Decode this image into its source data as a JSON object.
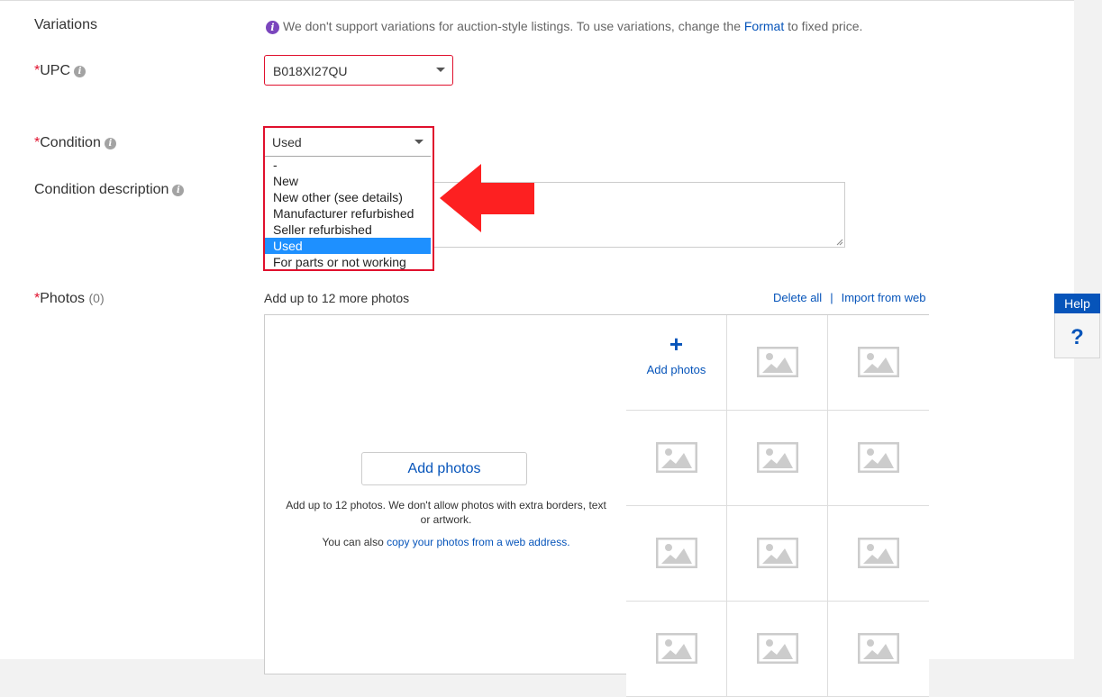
{
  "variations": {
    "label": "Variations",
    "note_before": "We don't support variations for auction-style listings. To use variations, change the ",
    "note_link": "Format",
    "note_after": " to fixed price."
  },
  "upc": {
    "label": "UPC",
    "value": "B018XI27QU"
  },
  "condition": {
    "label": "Condition",
    "value": "Used",
    "options": [
      "-",
      "New",
      "New other (see details)",
      "Manufacturer refurbished",
      "Seller refurbished",
      "Used",
      "For parts or not working"
    ],
    "selected_option": "Used"
  },
  "condition_description": {
    "label": "Condition description",
    "value": ""
  },
  "photos": {
    "label": "Photos",
    "count": "(0)",
    "hint": "Add up to 12 more photos",
    "delete_all": "Delete all",
    "separator": "|",
    "import_from_web": "Import from web",
    "add_photos_button": "Add photos",
    "add_tile_label": "Add photos",
    "add_tile_symbol": "+",
    "note": "Add up to 12 photos. We don't allow photos with extra borders, text or artwork.",
    "also_text": "You can also ",
    "also_link": "copy your photos from a web address."
  },
  "required_marker": "*",
  "help": {
    "title": "Help",
    "symbol": "?"
  },
  "colors": {
    "required": "#e0102d",
    "link": "#0654ba",
    "highlight": "#1e90ff",
    "annotation_arrow": "#fd2021",
    "info_icon": "#7b46bd"
  }
}
